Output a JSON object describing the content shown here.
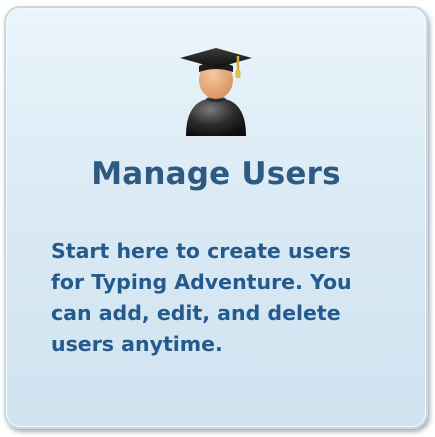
{
  "tile": {
    "title": "Manage Users",
    "description": "Start here to create users\nfor Typing Adventure.  You\ncan add, edit, and delete\nusers anytime.",
    "icon": "graduate-user-icon"
  },
  "colors": {
    "title": "#2e5a82",
    "description": "#245a8c",
    "tile_background": "#dcebf5",
    "tile_border": "#c8d8e2"
  }
}
